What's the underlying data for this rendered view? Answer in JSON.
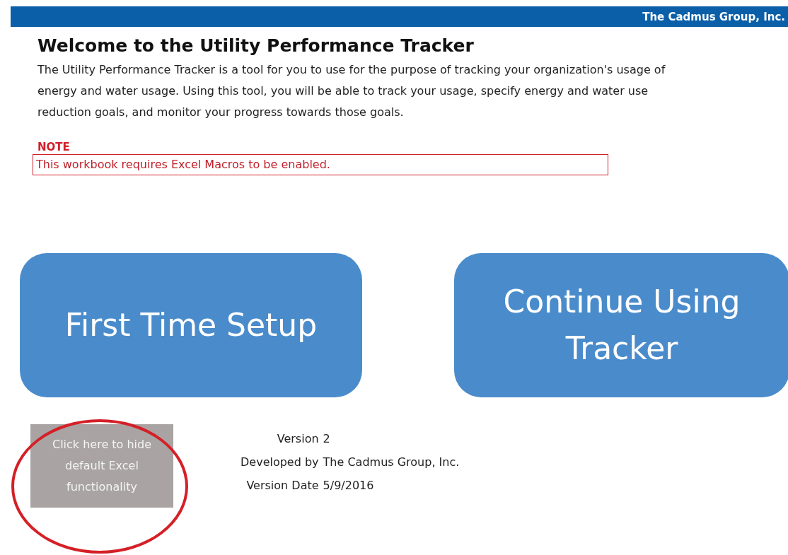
{
  "header": {
    "company": "The Cadmus Group, Inc."
  },
  "title": "Welcome to the Utility Performance Tracker",
  "intro": "The Utility Performance Tracker is a tool for you to use for the purpose of tracking your organization's usage of energy and water usage. Using this tool, you will be able to track your usage, specify energy and water use reduction goals, and monitor your progress towards those goals.",
  "note": {
    "label": "NOTE",
    "text": "This workbook requires Excel Macros to be enabled."
  },
  "buttons": [
    {
      "label": "First Time Setup"
    },
    {
      "label": "Continue Using Tracker"
    }
  ],
  "hide_button": {
    "label": "Click here to hide default Excel functionality",
    "highlighted": true
  },
  "info": [
    {
      "label": "Version",
      "value": "2"
    },
    {
      "label": "Developed by",
      "value": "The Cadmus Group, Inc."
    },
    {
      "label": "Version Date",
      "value": "5/9/2016"
    }
  ]
}
